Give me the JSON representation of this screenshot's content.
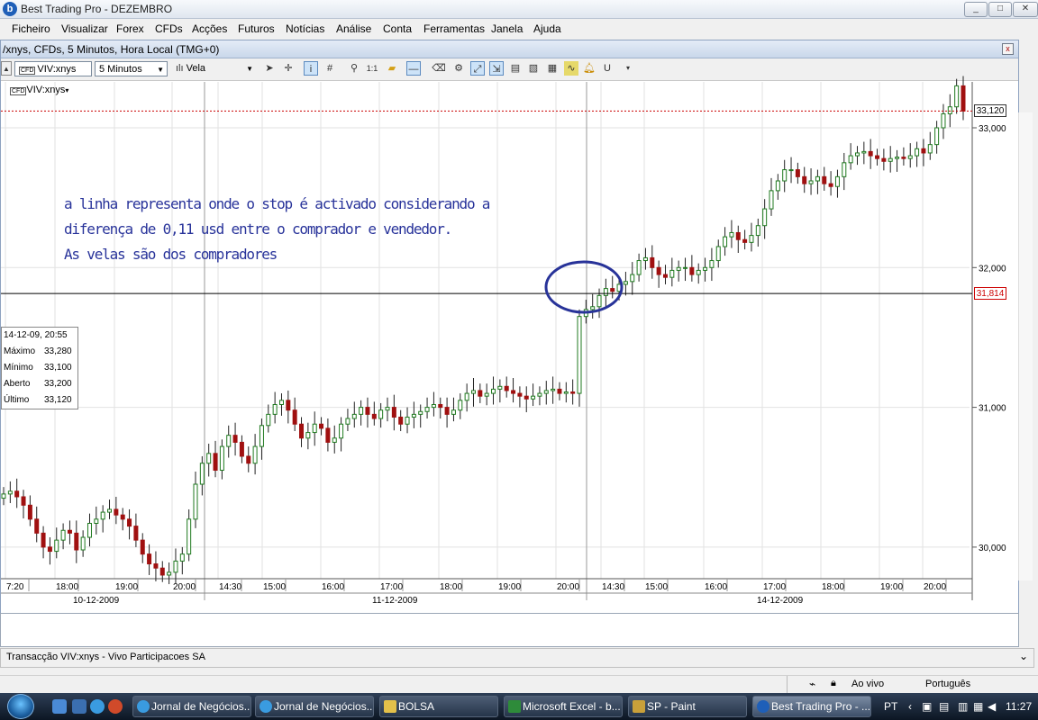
{
  "window": {
    "title": "Best Trading Pro - DEZEMBRO",
    "icon_letter": "b",
    "min": "_",
    "max": "□",
    "close": "✕"
  },
  "menu": [
    "Ficheiro",
    "Visualizar",
    "Forex",
    "CFDs",
    "Acções",
    "Futuros",
    "Notícias",
    "Análise",
    "Conta",
    "Ferramentas",
    "Janela",
    "Ajuda"
  ],
  "chart_window": {
    "title": "/xnys, CFDs, 5 Minutos, Hora Local (TMG+0)",
    "close": "x",
    "symbol_input": "VIV:xnys",
    "interval_select": "5 Minutos",
    "type_select": "Vela",
    "chart_label": "VIV:xnys",
    "chart_label_icon": "CFD",
    "scroll_left": "▲"
  },
  "annotation": [
    "a linha representa onde o stop é activado considerando a",
    "diferença de 0,11 usd entre o comprador e vendedor.",
    "As velas são dos compradores"
  ],
  "ohlc": {
    "header": "14-12-09, 20:55",
    "rows": [
      {
        "label": "Máximo",
        "value": "33,280"
      },
      {
        "label": "Mínimo",
        "value": "33,100"
      },
      {
        "label": "Aberto",
        "value": "33,200"
      },
      {
        "label": "Último",
        "value": "33,120"
      }
    ]
  },
  "price_tags": {
    "last": "33,120",
    "line": "31,814"
  },
  "colors": {
    "up": "#1f7a1f",
    "down": "#a01010",
    "annotation": "#28339a",
    "circle": "#283399",
    "stop_line": "#cc0000"
  },
  "chart_data": {
    "type": "candlestick",
    "y_ticks": [
      "33,000",
      "32,000",
      "31,000",
      "30,000"
    ],
    "y_tick_values": [
      33.0,
      32.0,
      31.0,
      30.0
    ],
    "ylim": [
      29.3,
      34.3
    ],
    "x_ticks": [
      "7:20",
      "18:00",
      "19:00",
      "20:00",
      "14:30",
      "15:00",
      "16:00",
      "17:00",
      "18:00",
      "19:00",
      "20:00",
      "14:30",
      "15:00",
      "16:00",
      "17:00",
      "18:00",
      "19:00",
      "20:00"
    ],
    "dates": [
      "10-12-2009",
      "11-12-2009",
      "14-12-2009"
    ],
    "stop_level": 31.814,
    "last_price": 33.12,
    "closes": [
      30.38,
      30.4,
      30.36,
      30.3,
      30.2,
      30.1,
      30.0,
      29.97,
      30.05,
      30.12,
      30.1,
      29.98,
      30.07,
      30.17,
      30.2,
      30.25,
      30.27,
      30.23,
      30.2,
      30.15,
      30.05,
      29.95,
      29.88,
      29.85,
      29.8,
      29.82,
      29.9,
      29.95,
      30.2,
      30.45,
      30.6,
      30.67,
      30.55,
      30.72,
      30.8,
      30.75,
      30.65,
      30.6,
      30.72,
      30.87,
      30.95,
      31.02,
      31.05,
      30.98,
      30.88,
      30.78,
      30.82,
      30.88,
      30.85,
      30.75,
      30.78,
      30.88,
      30.92,
      30.95,
      31.0,
      30.95,
      30.92,
      30.98,
      31.0,
      30.93,
      30.88,
      30.93,
      30.95,
      30.97,
      31.0,
      31.02,
      31.0,
      30.95,
      30.98,
      31.05,
      31.1,
      31.12,
      31.08,
      31.1,
      31.13,
      31.15,
      31.12,
      31.1,
      31.08,
      31.06,
      31.08,
      31.1,
      31.12,
      31.13,
      31.1,
      31.11,
      31.1,
      31.65,
      31.7,
      31.72,
      31.8,
      31.85,
      31.83,
      31.88,
      31.9,
      31.95,
      32.05,
      32.07,
      32.0,
      31.95,
      31.93,
      31.98,
      32.0,
      32.0,
      31.95,
      31.98,
      32.0,
      32.05,
      32.15,
      32.22,
      32.25,
      32.2,
      32.18,
      32.23,
      32.3,
      32.42,
      32.55,
      32.62,
      32.7,
      32.7,
      32.65,
      32.6,
      32.62,
      32.65,
      32.6,
      32.58,
      32.65,
      32.75,
      32.8,
      32.82,
      32.83,
      32.8,
      32.78,
      32.76,
      32.78,
      32.79,
      32.78,
      32.8,
      32.85,
      32.82,
      32.88,
      33.0,
      33.1,
      33.15,
      33.3,
      33.12
    ]
  },
  "sub_panel": {},
  "transaction_bar": {
    "text": "Transacção VIV:xnys - Vivo Participacoes SA",
    "arrow": "⌄"
  },
  "status": {
    "live": "Ao vivo",
    "language": "Português"
  },
  "taskbar": {
    "buttons": [
      "Jornal de Negócios...",
      "Jornal de Negócios...",
      "BOLSA",
      "Microsoft Excel - b...",
      "SP - Paint",
      "Best Trading Pro - ..."
    ],
    "lang": "PT",
    "clock": "11:27"
  }
}
